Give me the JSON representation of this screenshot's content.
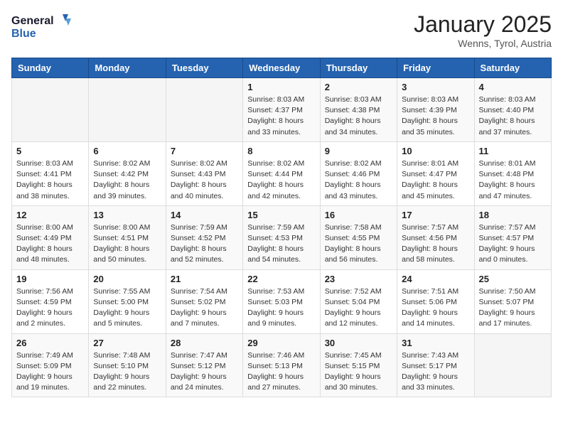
{
  "header": {
    "logo_general": "General",
    "logo_blue": "Blue",
    "month": "January 2025",
    "location": "Wenns, Tyrol, Austria"
  },
  "weekdays": [
    "Sunday",
    "Monday",
    "Tuesday",
    "Wednesday",
    "Thursday",
    "Friday",
    "Saturday"
  ],
  "weeks": [
    [
      {
        "day": "",
        "info": ""
      },
      {
        "day": "",
        "info": ""
      },
      {
        "day": "",
        "info": ""
      },
      {
        "day": "1",
        "info": "Sunrise: 8:03 AM\nSunset: 4:37 PM\nDaylight: 8 hours\nand 33 minutes."
      },
      {
        "day": "2",
        "info": "Sunrise: 8:03 AM\nSunset: 4:38 PM\nDaylight: 8 hours\nand 34 minutes."
      },
      {
        "day": "3",
        "info": "Sunrise: 8:03 AM\nSunset: 4:39 PM\nDaylight: 8 hours\nand 35 minutes."
      },
      {
        "day": "4",
        "info": "Sunrise: 8:03 AM\nSunset: 4:40 PM\nDaylight: 8 hours\nand 37 minutes."
      }
    ],
    [
      {
        "day": "5",
        "info": "Sunrise: 8:03 AM\nSunset: 4:41 PM\nDaylight: 8 hours\nand 38 minutes."
      },
      {
        "day": "6",
        "info": "Sunrise: 8:02 AM\nSunset: 4:42 PM\nDaylight: 8 hours\nand 39 minutes."
      },
      {
        "day": "7",
        "info": "Sunrise: 8:02 AM\nSunset: 4:43 PM\nDaylight: 8 hours\nand 40 minutes."
      },
      {
        "day": "8",
        "info": "Sunrise: 8:02 AM\nSunset: 4:44 PM\nDaylight: 8 hours\nand 42 minutes."
      },
      {
        "day": "9",
        "info": "Sunrise: 8:02 AM\nSunset: 4:46 PM\nDaylight: 8 hours\nand 43 minutes."
      },
      {
        "day": "10",
        "info": "Sunrise: 8:01 AM\nSunset: 4:47 PM\nDaylight: 8 hours\nand 45 minutes."
      },
      {
        "day": "11",
        "info": "Sunrise: 8:01 AM\nSunset: 4:48 PM\nDaylight: 8 hours\nand 47 minutes."
      }
    ],
    [
      {
        "day": "12",
        "info": "Sunrise: 8:00 AM\nSunset: 4:49 PM\nDaylight: 8 hours\nand 48 minutes."
      },
      {
        "day": "13",
        "info": "Sunrise: 8:00 AM\nSunset: 4:51 PM\nDaylight: 8 hours\nand 50 minutes."
      },
      {
        "day": "14",
        "info": "Sunrise: 7:59 AM\nSunset: 4:52 PM\nDaylight: 8 hours\nand 52 minutes."
      },
      {
        "day": "15",
        "info": "Sunrise: 7:59 AM\nSunset: 4:53 PM\nDaylight: 8 hours\nand 54 minutes."
      },
      {
        "day": "16",
        "info": "Sunrise: 7:58 AM\nSunset: 4:55 PM\nDaylight: 8 hours\nand 56 minutes."
      },
      {
        "day": "17",
        "info": "Sunrise: 7:57 AM\nSunset: 4:56 PM\nDaylight: 8 hours\nand 58 minutes."
      },
      {
        "day": "18",
        "info": "Sunrise: 7:57 AM\nSunset: 4:57 PM\nDaylight: 9 hours\nand 0 minutes."
      }
    ],
    [
      {
        "day": "19",
        "info": "Sunrise: 7:56 AM\nSunset: 4:59 PM\nDaylight: 9 hours\nand 2 minutes."
      },
      {
        "day": "20",
        "info": "Sunrise: 7:55 AM\nSunset: 5:00 PM\nDaylight: 9 hours\nand 5 minutes."
      },
      {
        "day": "21",
        "info": "Sunrise: 7:54 AM\nSunset: 5:02 PM\nDaylight: 9 hours\nand 7 minutes."
      },
      {
        "day": "22",
        "info": "Sunrise: 7:53 AM\nSunset: 5:03 PM\nDaylight: 9 hours\nand 9 minutes."
      },
      {
        "day": "23",
        "info": "Sunrise: 7:52 AM\nSunset: 5:04 PM\nDaylight: 9 hours\nand 12 minutes."
      },
      {
        "day": "24",
        "info": "Sunrise: 7:51 AM\nSunset: 5:06 PM\nDaylight: 9 hours\nand 14 minutes."
      },
      {
        "day": "25",
        "info": "Sunrise: 7:50 AM\nSunset: 5:07 PM\nDaylight: 9 hours\nand 17 minutes."
      }
    ],
    [
      {
        "day": "26",
        "info": "Sunrise: 7:49 AM\nSunset: 5:09 PM\nDaylight: 9 hours\nand 19 minutes."
      },
      {
        "day": "27",
        "info": "Sunrise: 7:48 AM\nSunset: 5:10 PM\nDaylight: 9 hours\nand 22 minutes."
      },
      {
        "day": "28",
        "info": "Sunrise: 7:47 AM\nSunset: 5:12 PM\nDaylight: 9 hours\nand 24 minutes."
      },
      {
        "day": "29",
        "info": "Sunrise: 7:46 AM\nSunset: 5:13 PM\nDaylight: 9 hours\nand 27 minutes."
      },
      {
        "day": "30",
        "info": "Sunrise: 7:45 AM\nSunset: 5:15 PM\nDaylight: 9 hours\nand 30 minutes."
      },
      {
        "day": "31",
        "info": "Sunrise: 7:43 AM\nSunset: 5:17 PM\nDaylight: 9 hours\nand 33 minutes."
      },
      {
        "day": "",
        "info": ""
      }
    ]
  ]
}
